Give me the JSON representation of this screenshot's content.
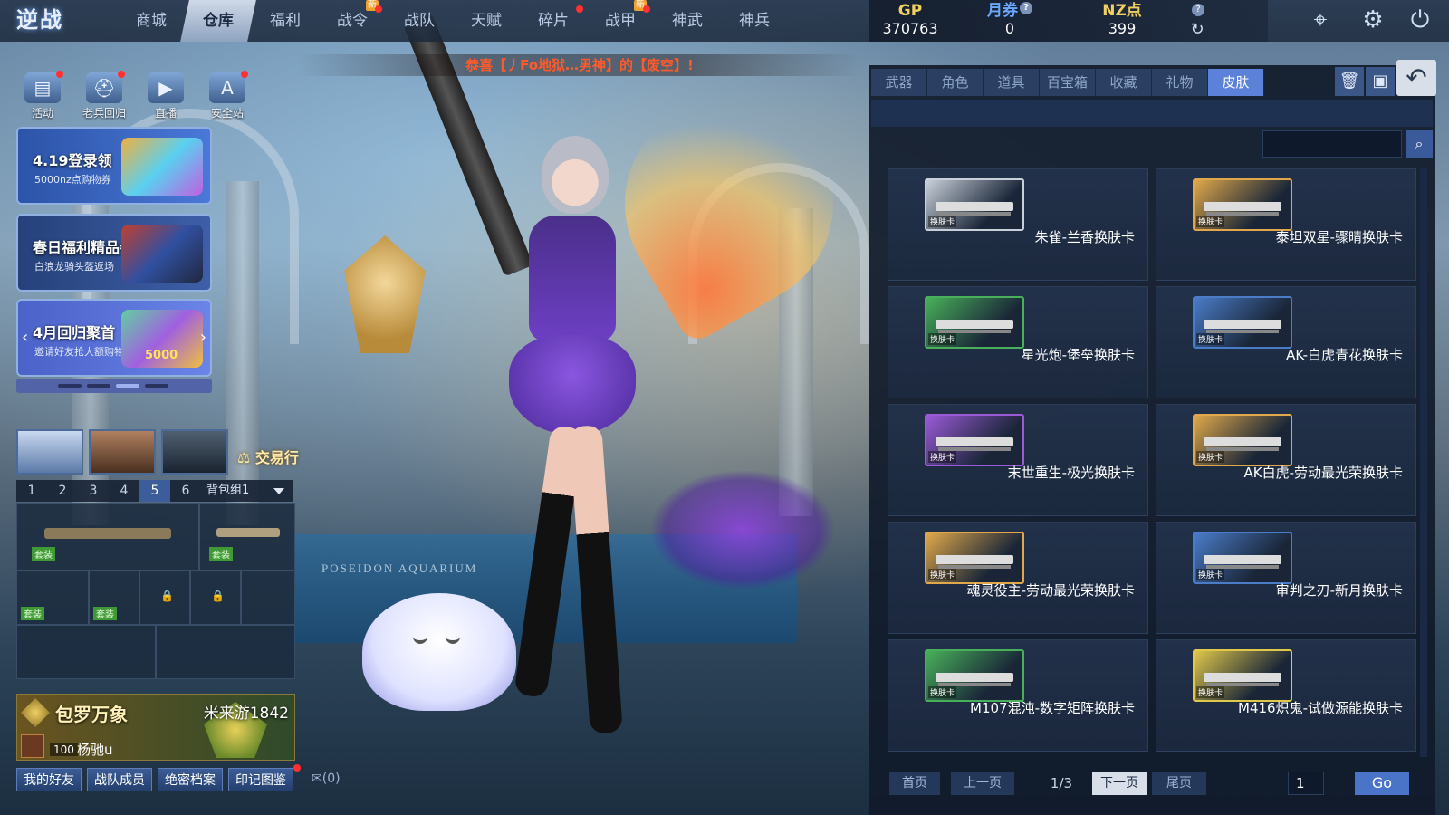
{
  "logo": "逆战",
  "nav": [
    {
      "label": "商城",
      "badge": ""
    },
    {
      "label": "仓库",
      "badge": "",
      "active": true
    },
    {
      "label": "福利",
      "badge": ""
    },
    {
      "label": "战令",
      "badge": "新"
    },
    {
      "label": "战队",
      "badge": ""
    },
    {
      "label": "天赋",
      "badge": ""
    },
    {
      "label": "碎片",
      "badge": ""
    },
    {
      "label": "战甲",
      "badge": "新"
    },
    {
      "label": "神武",
      "badge": ""
    },
    {
      "label": "神兵",
      "badge": ""
    }
  ],
  "currency": {
    "gp": {
      "label": "GP",
      "value": "370763",
      "color": "#f2d060"
    },
    "coupon": {
      "label": "月券",
      "value": "0",
      "color": "#6aa8ff"
    },
    "nz": {
      "label": "NZ点",
      "value": "399",
      "color": "#f2d060"
    },
    "refresh_help": "?"
  },
  "marquee": "恭喜【丿Fo地狱…男神】的【废空】!",
  "quick_icons": [
    {
      "label": "活动",
      "icon": "gift-icon"
    },
    {
      "label": "老兵回归",
      "icon": "helmet-icon"
    },
    {
      "label": "直播",
      "icon": "tv-icon"
    },
    {
      "label": "安全站",
      "icon": "ace-icon"
    }
  ],
  "banners": [
    {
      "title": "4.19登录领",
      "sub": "5000nz点购物券",
      "color": "#3f6cc8"
    },
    {
      "title": "春日福利精品会",
      "sub": "白浪龙骑头盔返场",
      "color": "#3a5a9c"
    },
    {
      "title": "4月回归聚首",
      "sub": "邀请好友抢大额购物券",
      "color": "#5b6ed0",
      "art_text": "5000"
    }
  ],
  "trade_label": "交易行",
  "bag": {
    "tabs": [
      "1",
      "2",
      "3",
      "4",
      "5",
      "6"
    ],
    "active_tab": "5",
    "group": "背包组1",
    "slot_tag": "套装"
  },
  "profile": {
    "title": "包罗万象",
    "name": "米来游1842",
    "level": "100",
    "user": "杨驰u"
  },
  "bottom_buttons": [
    "我的好友",
    "战队成员",
    "绝密档案",
    "印记图鉴"
  ],
  "mail_count": "(0)",
  "panel": {
    "tabs": [
      "武器",
      "角色",
      "道具",
      "百宝箱",
      "收藏",
      "礼物",
      "皮肤"
    ],
    "active_tab": "皮肤",
    "search_placeholder": "",
    "card_tag": "换肤卡",
    "items": [
      {
        "name": "朱雀-兰香换肤卡",
        "frame": "#c9d0da"
      },
      {
        "name": "泰坦双星-骤晴换肤卡",
        "frame": "#e0a84a"
      },
      {
        "name": "星光炮-堡垒换肤卡",
        "frame": "#48b05a"
      },
      {
        "name": "AK-白虎青花换肤卡",
        "frame": "#4a7cc8"
      },
      {
        "name": "末世重生-极光换肤卡",
        "frame": "#9b5ad8"
      },
      {
        "name": "AK白虎-劳动最光荣换肤卡",
        "frame": "#e0a84a"
      },
      {
        "name": "魂灵役主-劳动最光荣换肤卡",
        "frame": "#e0a84a"
      },
      {
        "name": "审判之刃-新月换肤卡",
        "frame": "#4a7cc8"
      },
      {
        "name": "M107混沌-数字矩阵换肤卡",
        "frame": "#48b05a"
      },
      {
        "name": "M416炽鬼-试做源能换肤卡",
        "frame": "#e0c84a"
      }
    ],
    "pager": {
      "first": "首页",
      "prev": "上一页",
      "info": "1/3",
      "next": "下一页",
      "last": "尾页",
      "page_input": "1",
      "go": "Go"
    }
  },
  "scene_text": "POSEIDON AQUARIUM"
}
